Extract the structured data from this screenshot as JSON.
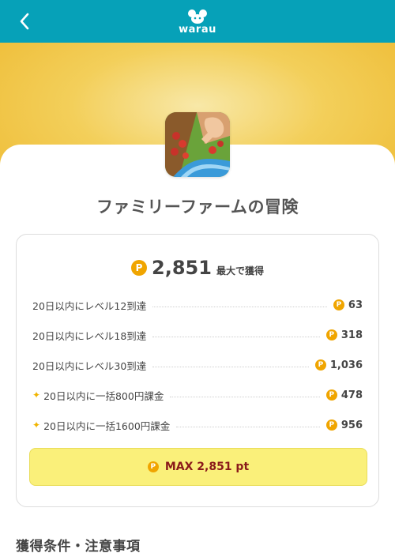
{
  "header": {
    "logo_text": "warau",
    "back_icon": "chevron-left-icon",
    "bg_color": "#06a1b8"
  },
  "app": {
    "title": "ファミリーファームの冒険"
  },
  "reward": {
    "coin_letter": "P",
    "total": "2,851",
    "total_suffix": "最大で獲得",
    "rows": [
      {
        "label": "20日以内にレベル12到達",
        "value": "63",
        "highlight": false
      },
      {
        "label": "20日以内にレベル18到達",
        "value": "318",
        "highlight": false
      },
      {
        "label": "20日以内にレベル30到達",
        "value": "1,036",
        "highlight": false
      },
      {
        "label": "20日以内に一括800円課金",
        "value": "478",
        "highlight": true
      },
      {
        "label": "20日以内に一括1600円課金",
        "value": "956",
        "highlight": true
      }
    ],
    "max_button_label": "MAX 2,851 pt"
  },
  "section": {
    "title": "獲得条件・注意事項"
  },
  "colors": {
    "accent": "#06a1b8",
    "coin": "#f0a500",
    "max_button_bg": "#faf07a",
    "max_button_text": "#8a1a1a"
  }
}
